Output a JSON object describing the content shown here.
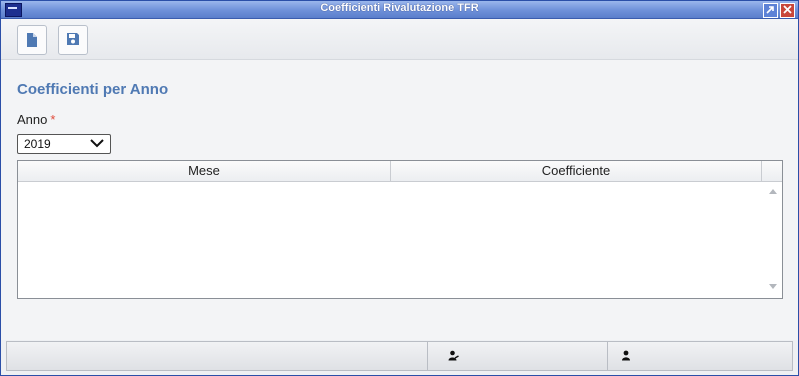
{
  "window": {
    "title": "Coefficienti Rivalutazione TFR"
  },
  "toolbar": {
    "new_icon": "new-document-icon",
    "save_icon": "save-floppy-icon"
  },
  "form": {
    "section_title": "Coefficienti per Anno",
    "anno_label": "Anno",
    "required_marker": "*",
    "anno_value": "2019"
  },
  "grid": {
    "columns": [
      "Mese",
      "Coefficiente"
    ],
    "rows": []
  },
  "statusbar": {
    "icons": [
      "user-edit-icon",
      "user-icon"
    ]
  },
  "colors": {
    "accent": "#4f79b3",
    "required": "#e04b3a",
    "titlebar": "#6e90d9"
  }
}
